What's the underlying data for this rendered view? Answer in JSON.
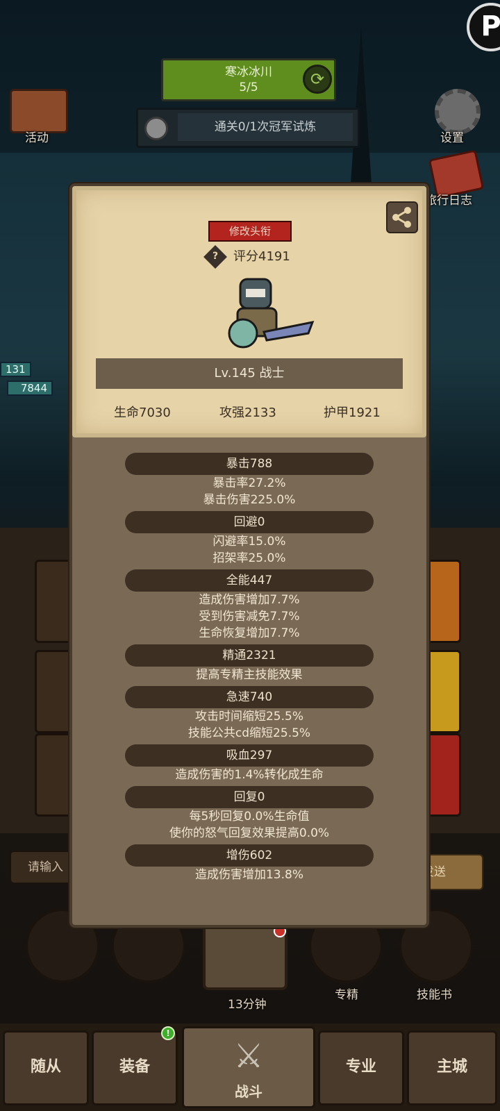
{
  "stage": {
    "title": "寒冰冰川",
    "progress": "5/5",
    "quest": "通关0/1次冠军试炼"
  },
  "side": {
    "activity": "活动",
    "settings": "设置",
    "travel_log": "旅行日志"
  },
  "hp_numbers": [
    "131",
    "7844"
  ],
  "chat": {
    "input_placeholder": "请输入",
    "send": "发送"
  },
  "dock": {
    "chest_timer": "13分钟",
    "mastery": "专精",
    "skill_book": "技能书"
  },
  "nav": {
    "followers": "随从",
    "equipment": "装备",
    "battle": "战斗",
    "profession": "专业",
    "main_city": "主城",
    "equipment_badge": "!"
  },
  "profile": {
    "rename_button": "修改头衔",
    "score_icon": "?",
    "score": "评分4191",
    "level_class": "Lv.145 战士",
    "hp": "生命7030",
    "attack": "攻强2133",
    "armor": "护甲1921"
  },
  "stats": [
    {
      "header": "暴击788",
      "lines": [
        "暴击率27.2%",
        "暴击伤害225.0%"
      ]
    },
    {
      "header": "回避0",
      "lines": [
        "闪避率15.0%",
        "招架率25.0%"
      ]
    },
    {
      "header": "全能447",
      "lines": [
        "造成伤害增加7.7%",
        "受到伤害减免7.7%",
        "生命恢复增加7.7%"
      ]
    },
    {
      "header": "精通2321",
      "lines": [
        "提高专精主技能效果"
      ]
    },
    {
      "header": "急速740",
      "lines": [
        "攻击时间缩短25.5%",
        "技能公共cd缩短25.5%"
      ]
    },
    {
      "header": "吸血297",
      "lines": [
        "造成伤害的1.4%转化成生命"
      ]
    },
    {
      "header": "回复0",
      "lines": [
        "每5秒回复0.0%生命值",
        "使你的怒气回复效果提高0.0%"
      ]
    },
    {
      "header": "增伤602",
      "lines": [
        "造成伤害增加13.8%"
      ]
    }
  ]
}
